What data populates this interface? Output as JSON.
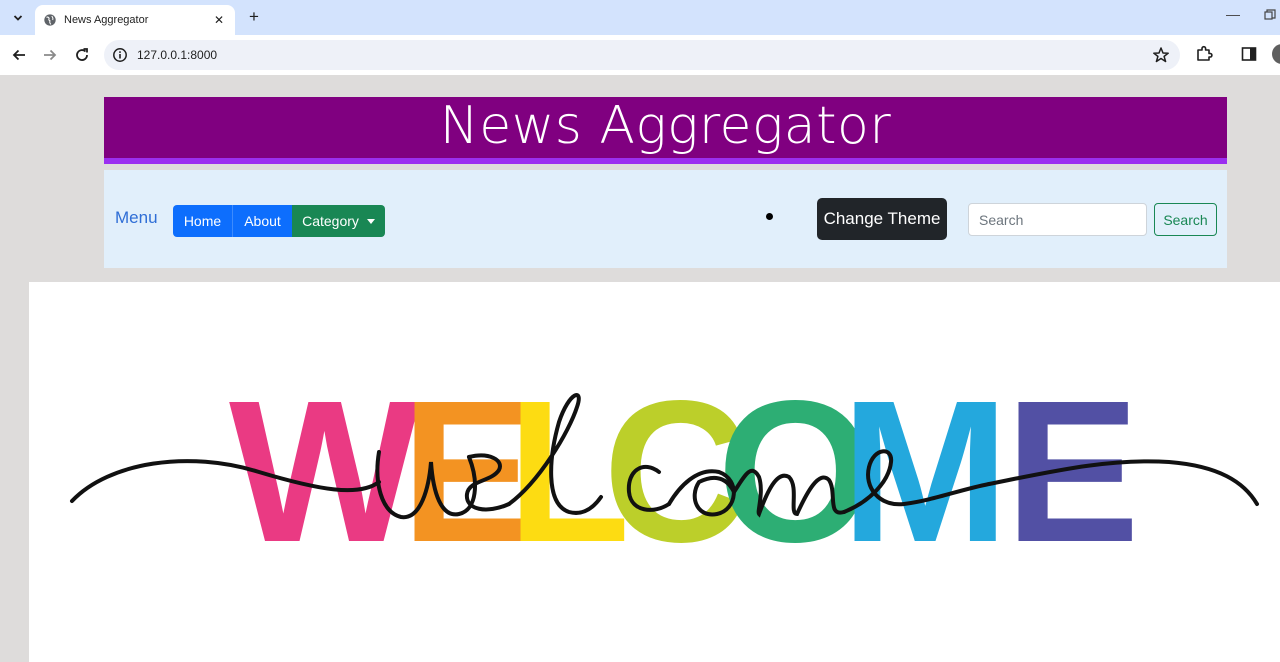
{
  "browser": {
    "tab_title": "News Aggregator",
    "url": "127.0.0.1:8000"
  },
  "header": {
    "title": "News Aggregator"
  },
  "navbar": {
    "brand": "Menu",
    "home_label": "Home",
    "about_label": "About",
    "category_label": "Category",
    "theme_button_label": "Change Theme",
    "search_placeholder": "Search",
    "search_button_label": "Search"
  },
  "banner": {
    "letters": [
      "W",
      "E",
      "L",
      "C",
      "O",
      "M",
      "E"
    ],
    "letter_colors": [
      "#ea3a83",
      "#f39322",
      "#fddc12",
      "#bccf2a",
      "#2dae74",
      "#24a8dd",
      "#5250a4"
    ],
    "script_text": "welcome"
  }
}
